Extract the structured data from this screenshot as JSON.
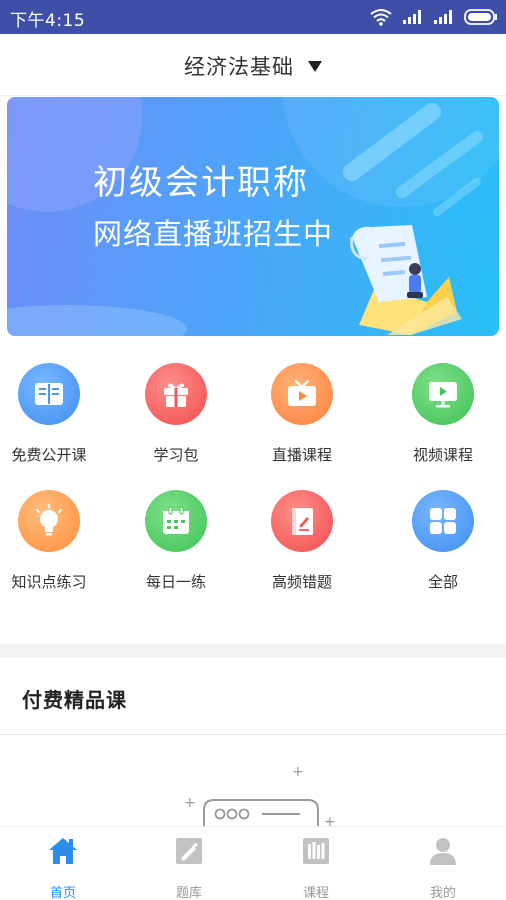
{
  "status_bar": {
    "time": "下午4:15"
  },
  "header": {
    "title": "经济法基础"
  },
  "banner": {
    "line1": "初级会计职称",
    "line2": "网络直播班招生中"
  },
  "grid": {
    "items": [
      {
        "label": "免费公开课",
        "icon": "book-icon",
        "color": "#3d93f0"
      },
      {
        "label": "学习包",
        "icon": "gift-icon",
        "color": "#f45a5a"
      },
      {
        "label": "直播课程",
        "icon": "tv-icon",
        "color": "#ff8f4f"
      },
      {
        "label": "视频课程",
        "icon": "video-icon",
        "color": "#45c75a"
      },
      {
        "label": "知识点练习",
        "icon": "lightbulb-icon",
        "color": "#ff9a4a"
      },
      {
        "label": "每日一练",
        "icon": "calendar-icon",
        "color": "#45c75a"
      },
      {
        "label": "高频错题",
        "icon": "notebook-icon",
        "color": "#f45a5a"
      },
      {
        "label": "全部",
        "icon": "grid-icon",
        "color": "#3d93f0"
      }
    ]
  },
  "section": {
    "title": "付费精品课"
  },
  "bottom_nav": {
    "items": [
      {
        "label": "首页",
        "icon": "home-icon",
        "active": true
      },
      {
        "label": "题库",
        "icon": "edit-icon",
        "active": false
      },
      {
        "label": "课程",
        "icon": "books-icon",
        "active": false
      },
      {
        "label": "我的",
        "icon": "user-icon",
        "active": false
      }
    ],
    "active_color": "#2a8de9",
    "inactive_color": "#bbbbbb"
  }
}
